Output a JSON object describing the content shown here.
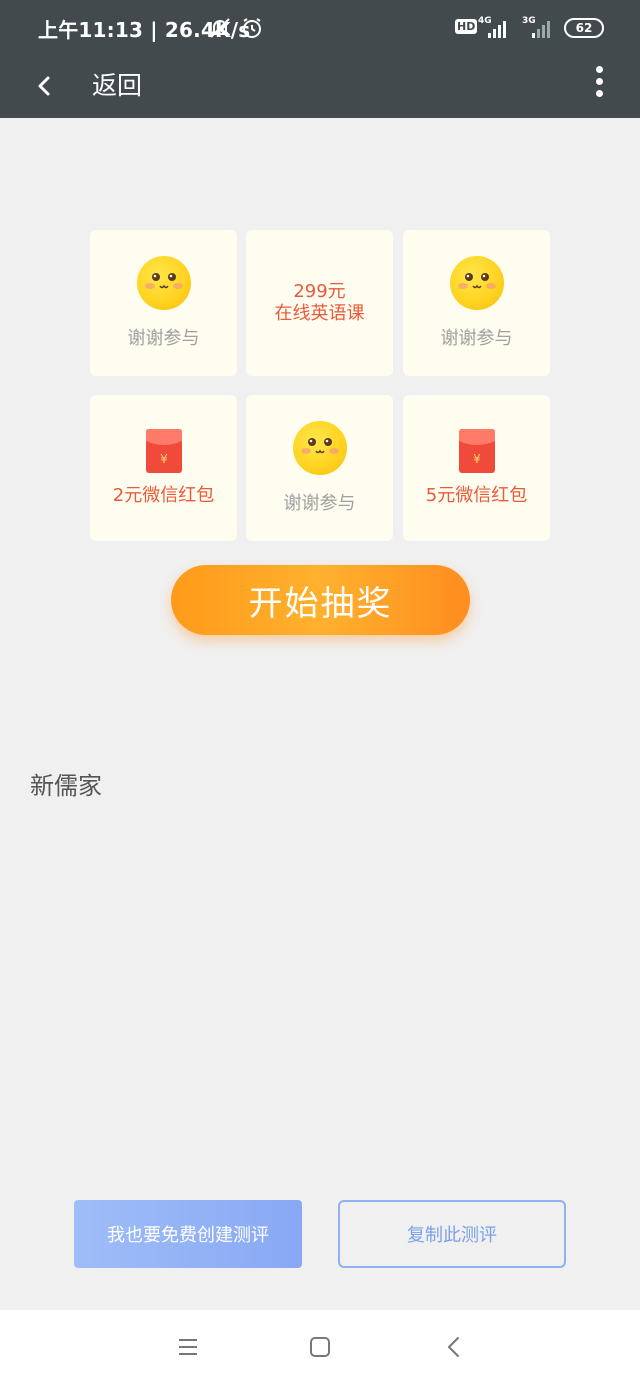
{
  "status_bar": {
    "time_speed": "上午11:13 | 26.4K/s",
    "hd": "HD",
    "network_4g": "4G",
    "network_3g": "3G",
    "battery": "62"
  },
  "nav": {
    "back_label": "返回"
  },
  "lottery": {
    "cells": [
      {
        "type": "smiley",
        "label": "谢谢参与"
      },
      {
        "type": "text",
        "line1": "299元",
        "line2": "在线英语课"
      },
      {
        "type": "smiley",
        "label": "谢谢参与"
      },
      {
        "type": "redpacket",
        "label": "2元微信红包"
      },
      {
        "type": "smiley",
        "label": "谢谢参与"
      },
      {
        "type": "redpacket",
        "label": "5元微信红包"
      }
    ],
    "start_button": "开始抽奖",
    "redpacket_symbol": "¥"
  },
  "brand_name": "新儒家",
  "actions": {
    "create_label": "我也要免费创建测评",
    "copy_label": "复制此测评"
  },
  "colors": {
    "header_bg": "#424a4d",
    "cell_bg": "#fffdf0",
    "accent_orange": "#ff9a1a",
    "prize_red": "#e95a3a",
    "button_blue": "#88a8f4"
  }
}
